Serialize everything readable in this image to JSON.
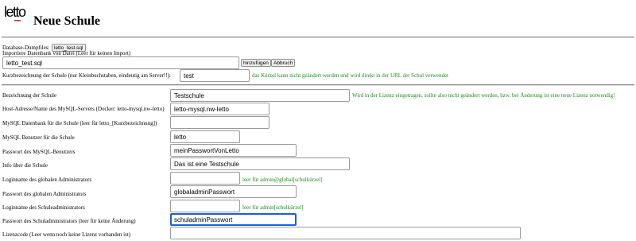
{
  "header": {
    "title": "Neue Schule",
    "logo_text": "letto"
  },
  "dump": {
    "label": "Database-Dumpfiles:",
    "file_button": "letto_test.sql",
    "import_label": "Importiere Datenbank von Datei (Leer für keinen Import)",
    "import_value": "letto_test.sql",
    "add_button": "hinzufügen",
    "cancel_button": "Abbruch"
  },
  "short": {
    "label": "Kurzbezeichnung der Schule (nur Kleinbuchstaben, eindeutig am Server!!):",
    "value": "test",
    "hint": "das Kürzel kann nicht geändert werden und wird direkt in der URL der Schul verwendet"
  },
  "form": {
    "rows": [
      {
        "label": "Bezeichnung der Schule",
        "value": "Testschule",
        "hint": "Wird in der Lizenz eingetragen, sollte also nicht geändert werden, bzw. bei Änderung ist eine neue Lizenz notwendig!"
      },
      {
        "label": "Host-Adresse/Name des MySQL-Servers (Docker: letto-mysql.nw-letto)",
        "value": "letto-mysql.nw-letto",
        "hint": ""
      },
      {
        "label": "MySQL Datenbank für die Schule (leer für letto_[Kurzbezeichnung])",
        "value": "",
        "hint": ""
      },
      {
        "label": "MySQL Benutzer für die Schule",
        "value": "letto",
        "hint": ""
      },
      {
        "label": "Passwort des MySQL-Benutzers",
        "value": "meinPasswortVonLetto",
        "hint": ""
      },
      {
        "label": "Info über die Schule",
        "value": "Das ist eine Testschule",
        "hint": ""
      },
      {
        "label": "Loginname des globalen Administrators",
        "value": "",
        "hint": "leer für admin@global[schulkürzel]"
      },
      {
        "label": "Passwort des globalen Administrators",
        "value": "globaladminPasswort",
        "hint": ""
      },
      {
        "label": "Loginname des Schuleadministrators",
        "value": "",
        "hint": "leer für admin[schulkürzel]"
      },
      {
        "label": "Passwort des Schuladministrators (leer für keine Änderung)",
        "value": "schuladminPasswort",
        "hint": ""
      },
      {
        "label": "Lizenzcode (Leer wenn noch keine Lizenz vorhanden ist)",
        "value": "",
        "hint": ""
      }
    ]
  },
  "colors": {
    "hint_green": "#1f8a1f",
    "focus_blue": "#1a5fd6"
  }
}
